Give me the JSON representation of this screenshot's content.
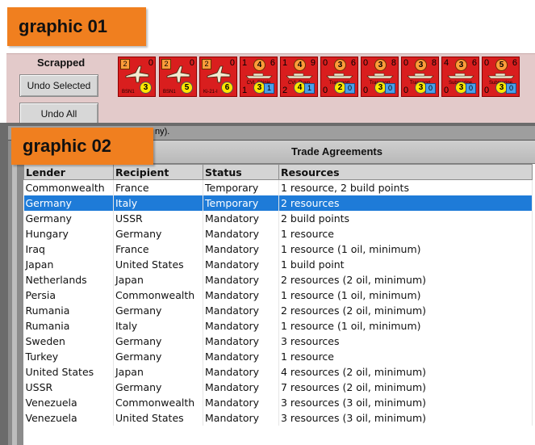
{
  "tags": {
    "graphic_01": "graphic 01",
    "graphic_02": "graphic 02"
  },
  "scrapped": {
    "label": "Scrapped",
    "undo_selected": "Undo Selected",
    "undo_all": "Undo All",
    "counters": [
      {
        "kind": "aircraft",
        "top_left": "2",
        "top_right": "0",
        "bottom_badge": "3",
        "caption": "BSN1"
      },
      {
        "kind": "aircraft",
        "top_left": "2",
        "top_right": "0",
        "bottom_badge": "5",
        "caption": "BSN1"
      },
      {
        "kind": "aircraft",
        "top_left": "2",
        "top_right": "0",
        "bottom_badge": "6",
        "caption": "Ki-21-I"
      },
      {
        "kind": "ship",
        "top_left": "1",
        "top_circle": "4",
        "top_right": "6",
        "caption": "CVL Shinie",
        "bl": "1",
        "badge": "3",
        "sq": "1"
      },
      {
        "kind": "ship",
        "top_left": "1",
        "top_circle": "4",
        "top_right": "9",
        "caption": "CVL Ruyo",
        "bl": "2",
        "badge": "4",
        "sq": "1"
      },
      {
        "kind": "ship",
        "top_left": "0",
        "top_circle": "3",
        "top_right": "6",
        "caption": "Transport",
        "bl": "0",
        "badge": "2",
        "sq": "0"
      },
      {
        "kind": "ship",
        "top_left": "0",
        "top_circle": "3",
        "top_right": "8",
        "caption": "Transport",
        "bl": "0",
        "badge": "3",
        "sq": "0"
      },
      {
        "kind": "ship",
        "top_left": "0",
        "top_circle": "3",
        "top_right": "8",
        "caption": "Transport",
        "bl": "0",
        "badge": "3",
        "sq": "0"
      },
      {
        "kind": "ship",
        "top_left": "4",
        "top_circle": "3",
        "top_right": "6",
        "caption": "Submarine",
        "bl": "0",
        "badge": "3",
        "sq": "0"
      },
      {
        "kind": "ship",
        "top_left": "0",
        "top_circle": "5",
        "top_right": "6",
        "caption": "Submarine",
        "bl": "0",
        "badge": "3",
        "sq": "0"
      }
    ]
  },
  "window": {
    "title_fragment": "ny)."
  },
  "trade": {
    "title": "Trade Agreements",
    "columns": [
      "Lender",
      "Recipient",
      "Status",
      "Resources"
    ],
    "selected_index": 1,
    "rows": [
      [
        "Commonwealth",
        "France",
        "Temporary",
        "1 resource, 2 build points"
      ],
      [
        "Germany",
        "Italy",
        "Temporary",
        "2 resources"
      ],
      [
        "Germany",
        "USSR",
        "Mandatory",
        "2 build points"
      ],
      [
        "Hungary",
        "Germany",
        "Mandatory",
        "1 resource"
      ],
      [
        "Iraq",
        "France",
        "Mandatory",
        "1 resource (1 oil, minimum)"
      ],
      [
        "Japan",
        "United States",
        "Mandatory",
        "1 build point"
      ],
      [
        "Netherlands",
        "Japan",
        "Mandatory",
        "2 resources (2 oil, minimum)"
      ],
      [
        "Persia",
        "Commonwealth",
        "Mandatory",
        "1 resource (1 oil, minimum)"
      ],
      [
        "Rumania",
        "Germany",
        "Mandatory",
        "2 resources (2 oil, minimum)"
      ],
      [
        "Rumania",
        "Italy",
        "Mandatory",
        "1 resource (1 oil, minimum)"
      ],
      [
        "Sweden",
        "Germany",
        "Mandatory",
        "3 resources"
      ],
      [
        "Turkey",
        "Germany",
        "Mandatory",
        "1 resource"
      ],
      [
        "United States",
        "Japan",
        "Mandatory",
        "4 resources (2 oil, minimum)"
      ],
      [
        "USSR",
        "Germany",
        "Mandatory",
        "7 resources (2 oil, minimum)"
      ],
      [
        "Venezuela",
        "Commonwealth",
        "Mandatory",
        "3 resources (3 oil, minimum)"
      ],
      [
        "Venezuela",
        "United States",
        "Mandatory",
        "3 resources (3 oil, minimum)"
      ]
    ]
  },
  "colors": {
    "counter_red": "#d91e1e",
    "selection_blue": "#1e7bd8",
    "tag_orange": "#f07f1f",
    "scrapped_bg": "#e3caca"
  }
}
